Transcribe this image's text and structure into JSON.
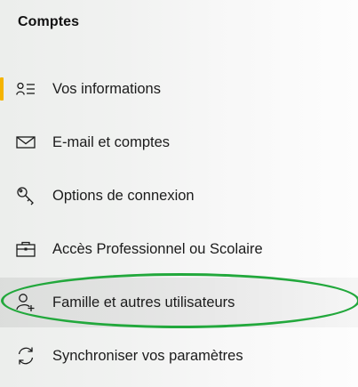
{
  "section": {
    "title": "Comptes"
  },
  "nav": {
    "items": [
      {
        "label": "Vos informations",
        "icon": "person-list-icon",
        "selected": true
      },
      {
        "label": "E-mail et comptes",
        "icon": "mail-icon",
        "selected": false
      },
      {
        "label": "Options de connexion",
        "icon": "key-icon",
        "selected": false
      },
      {
        "label": "Accès Professionnel ou Scolaire",
        "icon": "briefcase-icon",
        "selected": false
      },
      {
        "label": "Famille et autres utilisateurs",
        "icon": "add-person-icon",
        "selected": false,
        "highlighted": true
      },
      {
        "label": "Synchroniser vos paramètres",
        "icon": "sync-icon",
        "selected": false
      }
    ]
  },
  "colors": {
    "accent": "#f5b400",
    "annotation": "#22a83c"
  }
}
